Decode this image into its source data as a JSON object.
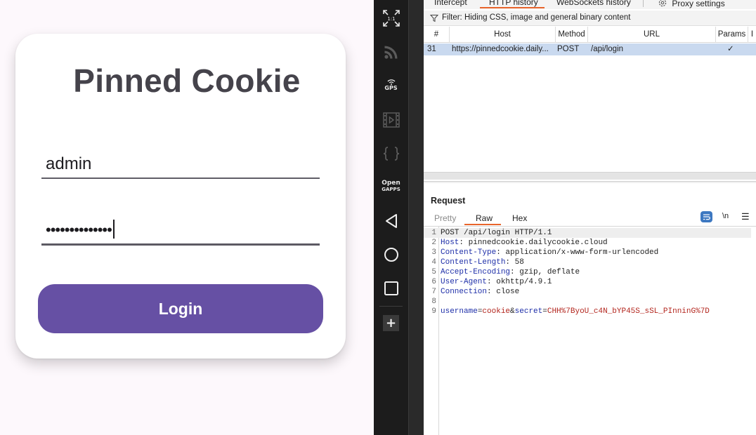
{
  "app": {
    "title": "Pinned Cookie",
    "username_value": "admin",
    "password_masked": "••••••••••••••",
    "login_label": "Login"
  },
  "emulator_toolbar": {
    "fit_label": "1:1",
    "gps_label": "GPS",
    "opengapps_line1": "Open",
    "opengapps_line2": "GAPPS",
    "icons": [
      "fullscreen-icon",
      "rss-icon",
      "gps-icon",
      "video-icon",
      "braces-icon",
      "opengapps-icon",
      "back-icon",
      "home-icon",
      "recents-icon",
      "plus-icon"
    ]
  },
  "burp": {
    "tabs": {
      "intercept": "Intercept",
      "http_history": "HTTP history",
      "websockets_history": "WebSockets history",
      "proxy_settings": "Proxy settings"
    },
    "filter_text": "Filter: Hiding CSS, image and general binary content",
    "table": {
      "headers": [
        "#",
        "Host",
        "Method",
        "URL",
        "Params",
        "I"
      ],
      "rows": [
        {
          "num": "31",
          "host": "https://pinnedcookie.daily...",
          "method": "POST",
          "url": "/api/login",
          "params": "✓"
        }
      ]
    },
    "request": {
      "title": "Request",
      "view_tabs": {
        "pretty": "Pretty",
        "raw": "Raw",
        "hex": "Hex"
      },
      "newline_toggle": "\\n",
      "lines": [
        {
          "n": "1",
          "text": "POST /api/login HTTP/1.1"
        },
        {
          "n": "2",
          "key": "Host",
          "value": "pinnedcookie.dailycookie.cloud"
        },
        {
          "n": "3",
          "key": "Content-Type",
          "value": "application/x-www-form-urlencoded"
        },
        {
          "n": "4",
          "key": "Content-Length",
          "value": "58"
        },
        {
          "n": "5",
          "key": "Accept-Encoding",
          "value": "gzip, deflate"
        },
        {
          "n": "6",
          "key": "User-Agent",
          "value": "okhttp/4.9.1"
        },
        {
          "n": "7",
          "key": "Connection",
          "value": "close"
        },
        {
          "n": "8",
          "text": ""
        },
        {
          "n": "9",
          "p1_name": "username",
          "p1_value": "cookie",
          "amp": "&",
          "p2_name": "secret",
          "p2_value": "CHH%7ByoU_c4N_bYP45S_sSL_PInninG%7D"
        }
      ]
    }
  },
  "colors": {
    "button_purple": "#6650a4",
    "burp_accent": "#e8642b",
    "selected_row": "#c9d9ef",
    "header_key_blue": "#1d2ea8",
    "param_value_red": "#b3261e"
  }
}
